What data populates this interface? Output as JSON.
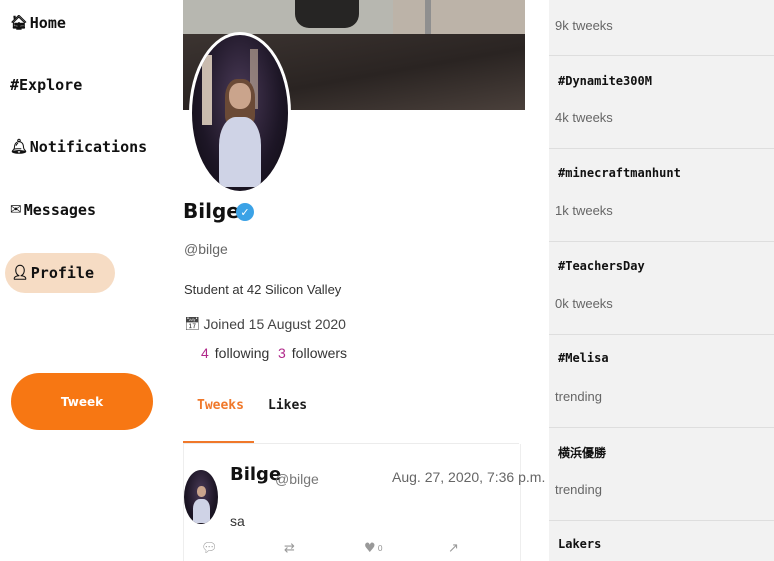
{
  "nav": {
    "items": [
      {
        "icon": "🏠",
        "icon_name": "home-icon",
        "label": "Home"
      },
      {
        "icon": "#",
        "icon_name": "hashtag-icon",
        "label": "Explore"
      },
      {
        "icon": "🔔",
        "icon_name": "bell-icon",
        "label": "Notifications"
      },
      {
        "icon": "✉",
        "icon_name": "envelope-icon",
        "label": "Messages"
      },
      {
        "icon": "👤",
        "icon_name": "user-icon",
        "label": "Profile"
      }
    ],
    "active": "Profile",
    "tweek_button": "Tweek"
  },
  "profile": {
    "name": "Bilge",
    "handle": "@bilge",
    "bio": "Student at 42 Silicon Valley",
    "joined": "Joined 15 August 2020",
    "following_count": "4",
    "following_label": "following",
    "followers_count": "3",
    "followers_label": "followers",
    "verified": true
  },
  "tabs": [
    {
      "label": "Tweeks",
      "active": true
    },
    {
      "label": "Likes",
      "active": false
    }
  ],
  "tweet": {
    "name": "Bilge",
    "handle": "@bilge",
    "time": "Aug. 27, 2020, 7:36 p.m.",
    "text": "sa",
    "like_count": "0"
  },
  "trends": [
    {
      "tag": "",
      "count": "9k tweeks"
    },
    {
      "tag": "#Dynamite300M",
      "count": "4k tweeks"
    },
    {
      "tag": "#minecraftmanhunt",
      "count": "1k tweeks"
    },
    {
      "tag": "#TeachersDay",
      "count": "0k tweeks"
    },
    {
      "tag": "#Melisa",
      "count": "trending"
    },
    {
      "tag": "横浜優勝",
      "count": "trending"
    },
    {
      "tag": "Lakers",
      "count": ""
    }
  ],
  "colors": {
    "accent": "#f77713",
    "active_nav_bg": "#f6dcc4",
    "verified": "#3ba2e6",
    "count_color": "#b0288a",
    "trends_bg": "#f2f2f2"
  }
}
